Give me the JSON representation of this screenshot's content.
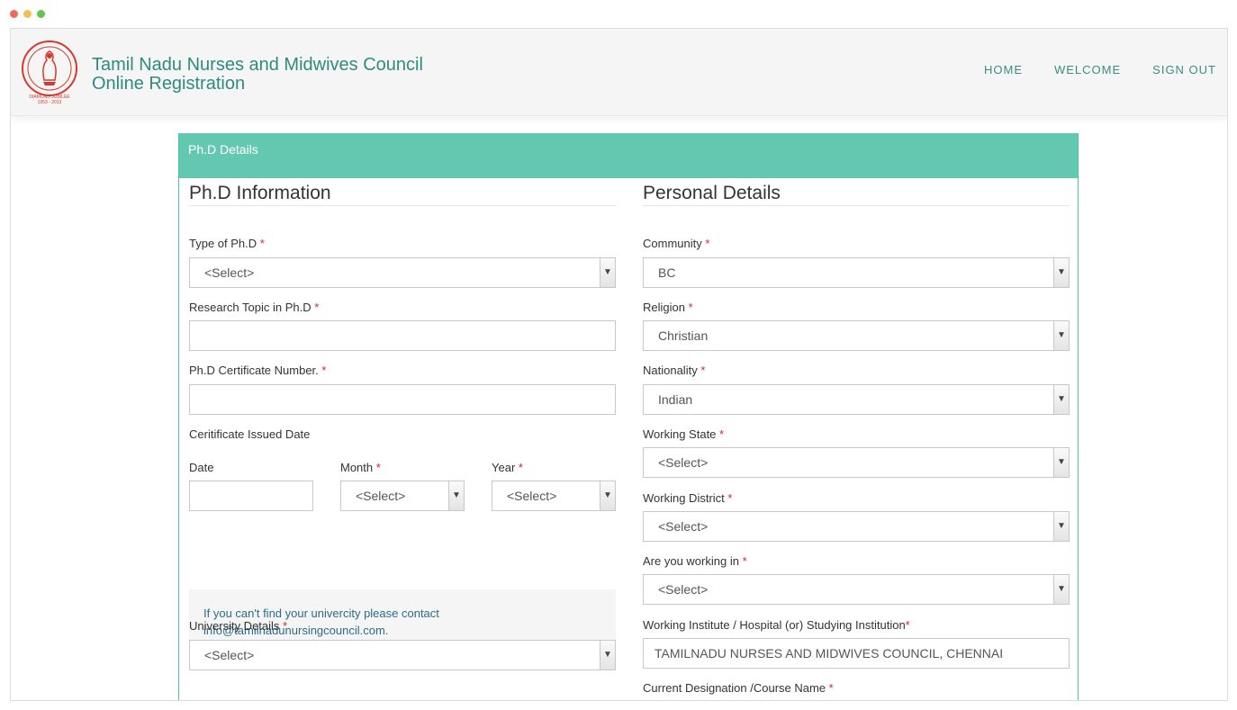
{
  "window": {
    "dots": [
      "#ed6a5e",
      "#f5bf4f",
      "#61c554"
    ]
  },
  "header": {
    "brand_line1": "Tamil Nadu Nurses and Midwives Council",
    "brand_line2": "Online Registration",
    "nav": [
      "HOME",
      "WELCOME",
      "SIGN OUT"
    ],
    "logo_icon": "council-seal-icon",
    "logo_text": "DIAMOND JUBILEE 1953 - 2013"
  },
  "panel": {
    "title": "Ph.D Details",
    "left": {
      "section_title": "Ph.D Information",
      "type_label": "Type of Ph.D",
      "type_value": "<Select>",
      "topic_label": "Research Topic in Ph.D",
      "topic_value": "",
      "cert_label": "Ph.D Certificate Number.",
      "cert_value": "",
      "issued_label": "Ceritificate Issued Date",
      "date_label": "Date",
      "date_value": "",
      "month_label": "Month",
      "month_value": "<Select>",
      "year_label": "Year",
      "year_value": "<Select>",
      "info_line1": "If you can't find your univercity please contact",
      "info_line2": "info@tamilnadunursingcouncil.com.",
      "university_label": "University Details",
      "university_value": "<Select>"
    },
    "right": {
      "section_title": "Personal Details",
      "community_label": "Community",
      "community_value": "BC",
      "religion_label": "Religion",
      "religion_value": "Christian",
      "nationality_label": "Nationality",
      "nationality_value": "Indian",
      "wstate_label": "Working State",
      "wstate_value": "<Select>",
      "wdistrict_label": "Working District",
      "wdistrict_value": "<Select>",
      "workingin_label": "Are you working in",
      "workingin_value": "<Select>",
      "institute_label": "Working Institute / Hospital (or) Studying Institution",
      "institute_value": "TAMILNADU NURSES AND MIDWIVES COUNCIL, CHENNAI",
      "designation_label": "Current Designation /Course Name"
    },
    "required_mark": "*",
    "select_arrow_icon": "chevron-down-icon"
  }
}
